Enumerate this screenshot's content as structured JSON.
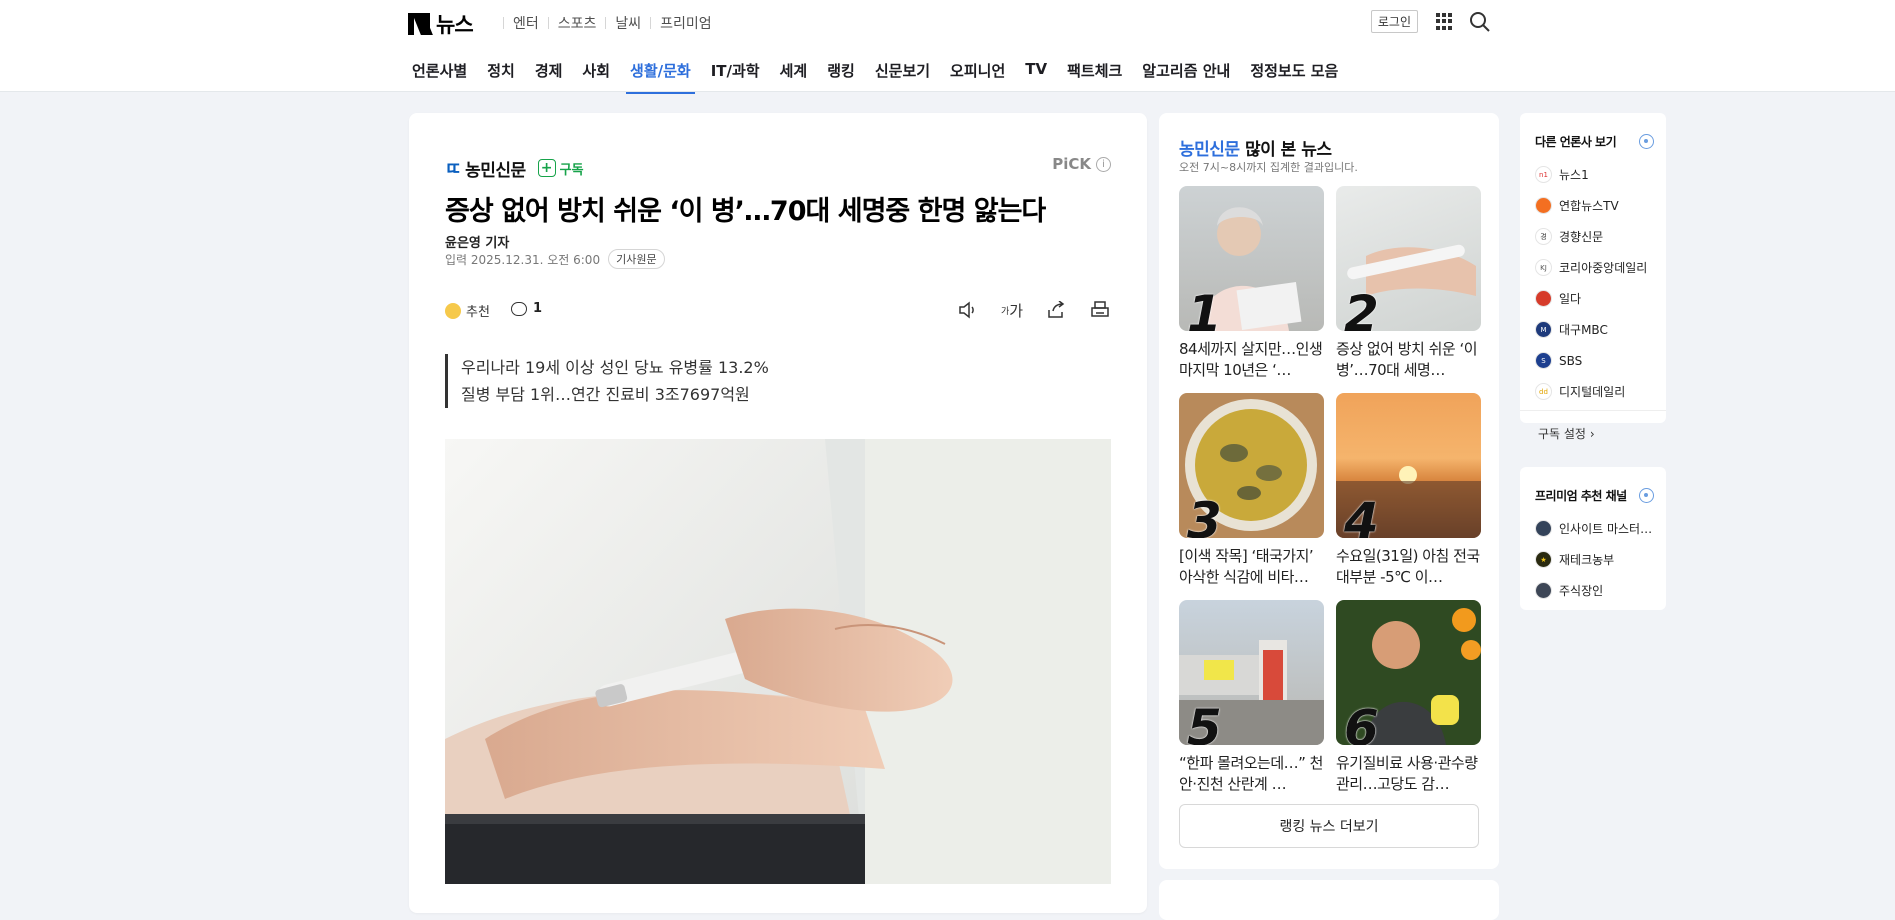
{
  "header": {
    "logo": "뉴스",
    "top_links": [
      "엔터",
      "스포츠",
      "날씨",
      "프리미엄"
    ],
    "login": "로그인"
  },
  "gnb": [
    "언론사별",
    "정치",
    "경제",
    "사회",
    "생활/문화",
    "IT/과학",
    "세계",
    "랭킹",
    "신문보기",
    "오피니언",
    "TV",
    "팩트체크",
    "알고리즘 안내",
    "정정보도 모음"
  ],
  "gnb_active": "생활/문화",
  "article": {
    "press": "농민신문",
    "subscribe": "구독",
    "pick": "PiCK",
    "headline": "증상 없어 방치 쉬운 ‘이 병’…70대 세명중 한명 앓는다",
    "reporter": "윤은영 기자",
    "date": "입력 2025.12.31. 오전 6:00",
    "original_btn": "기사원문",
    "recommend": "추천",
    "comment_count": "1",
    "font_size_label": "가",
    "summary": [
      "우리나라 19세 이상 성인 당뇨 유병률 13.2%",
      "질병 부담 1위…연간 진료비 3조7697억원"
    ]
  },
  "ranking": {
    "press": "농민신문",
    "title_suffix": " 많이 본 뉴스",
    "subtitle": "오전 7시~8시까지 집계한 결과입니다.",
    "items": [
      {
        "num": "1",
        "text": "84세까지 살지만…인생 마지막 10년은 ‘…"
      },
      {
        "num": "2",
        "text": "증상 없어 방치 쉬운 ‘이 병’…70대 세명…"
      },
      {
        "num": "3",
        "text": "[이색 작목] ‘태국가지’ 아삭한 식감에 비타…"
      },
      {
        "num": "4",
        "text": "수요일(31일) 아침 전국 대부분 -5℃ 이…"
      },
      {
        "num": "5",
        "text": "“한파 몰려오는데…” 천안·진천 산란계 …"
      },
      {
        "num": "6",
        "text": "유기질비료 사용·관수량 관리…고당도 감…"
      }
    ],
    "more": "랭킹 뉴스 더보기"
  },
  "rail_press": {
    "title": "다른 언론사 보기",
    "items": [
      "뉴스1",
      "연합뉴스TV",
      "경향신문",
      "코리아중앙데일리",
      "일다",
      "대구MBC",
      "SBS",
      "디지털데일리"
    ],
    "setting": "구독 설정"
  },
  "rail_premium": {
    "title": "프리미엄 추천 채널",
    "items": [
      "인사이트 마스터…",
      "재테크농부",
      "주식장인"
    ]
  },
  "colors": {
    "accent": "#2e6fdc",
    "subscribe": "#17a34a"
  }
}
